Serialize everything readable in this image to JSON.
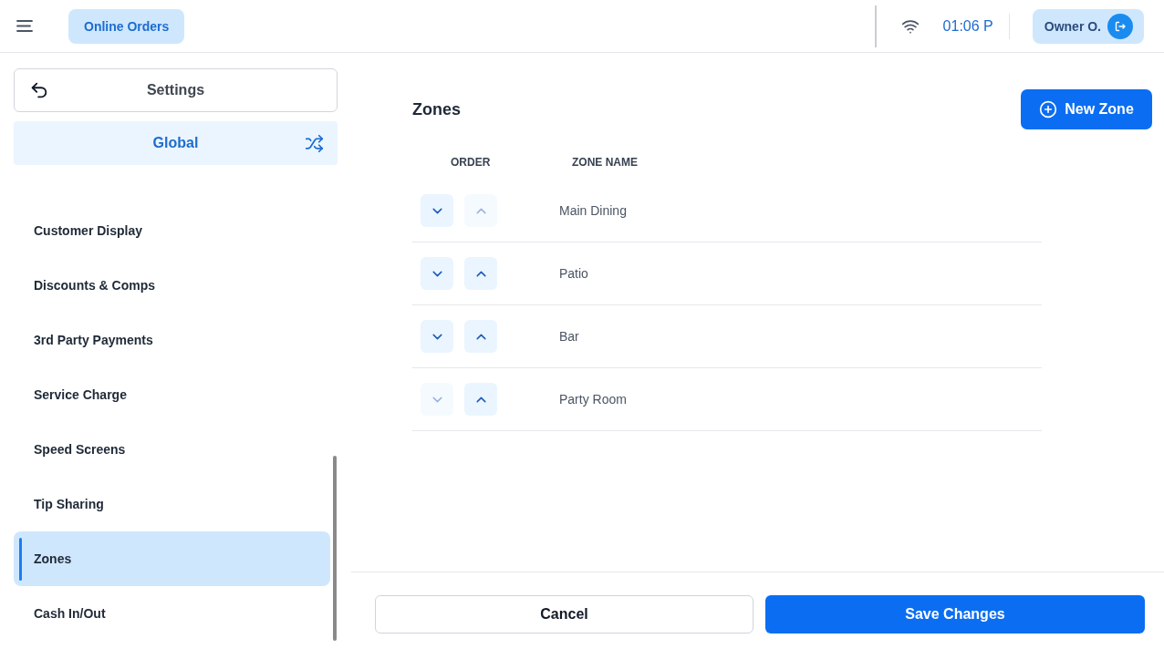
{
  "top_bar": {
    "module": "Online Orders",
    "time": "01:06 P",
    "user": "Owner O."
  },
  "sidebar": {
    "title": "Settings",
    "scope": "Global",
    "items": [
      {
        "label": "Customer Display",
        "selected": false
      },
      {
        "label": "Discounts & Comps",
        "selected": false
      },
      {
        "label": "3rd Party Payments",
        "selected": false
      },
      {
        "label": "Service Charge",
        "selected": false
      },
      {
        "label": "Speed Screens",
        "selected": false
      },
      {
        "label": "Tip Sharing",
        "selected": false
      },
      {
        "label": "Zones",
        "selected": true
      },
      {
        "label": "Cash In/Out",
        "selected": false
      }
    ]
  },
  "zones_panel": {
    "title": "Zones",
    "new_button": "New Zone",
    "columns": [
      "ORDER",
      "ZONE NAME"
    ],
    "rows": [
      {
        "name": "Main Dining",
        "down_disabled": false,
        "up_disabled": true
      },
      {
        "name": "Patio",
        "down_disabled": false,
        "up_disabled": false
      },
      {
        "name": "Bar",
        "down_disabled": false,
        "up_disabled": false
      },
      {
        "name": "Party Room",
        "down_disabled": true,
        "up_disabled": false
      }
    ]
  },
  "footer": {
    "cancel": "Cancel",
    "save": "Save Changes"
  }
}
